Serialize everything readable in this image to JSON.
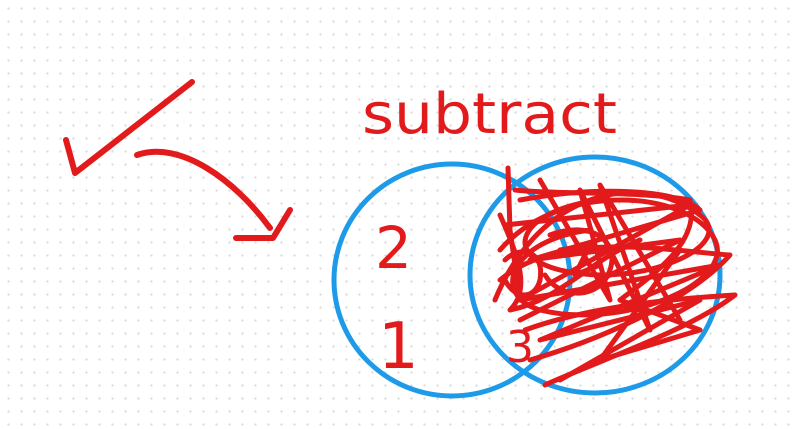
{
  "drawing": {
    "heading": "subtract",
    "left_numbers": [
      "2",
      "1"
    ],
    "overlap_number": "3",
    "colors": {
      "ink_red": "#e31a1c",
      "ink_blue": "#1e9be8",
      "grid_dot": "#d9d9d9"
    }
  }
}
